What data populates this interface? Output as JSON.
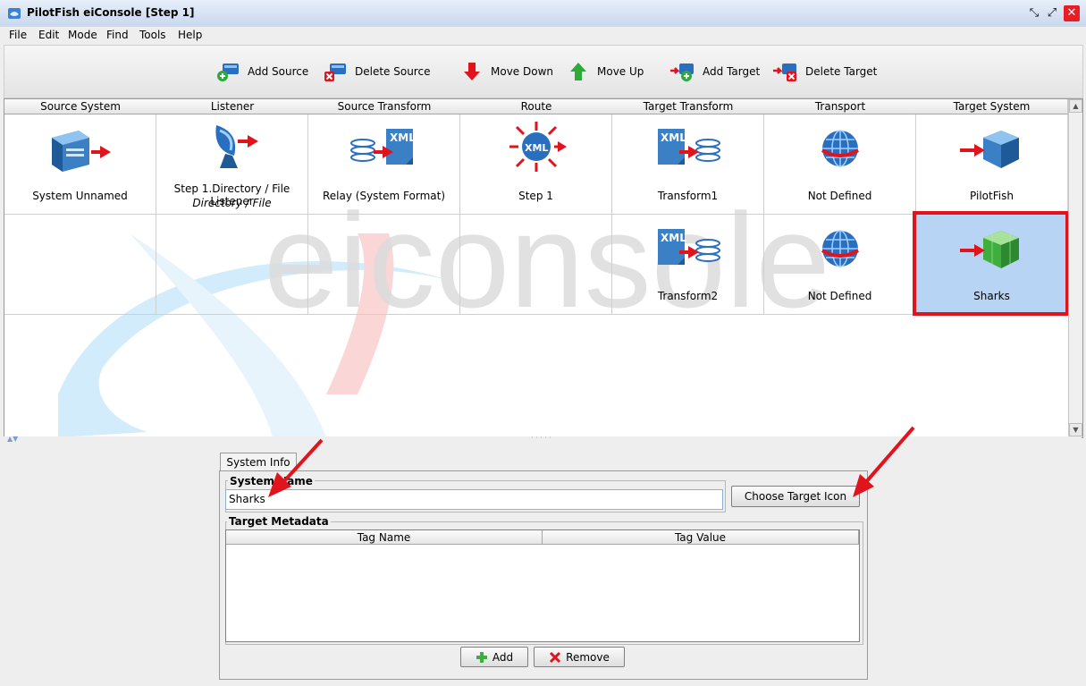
{
  "window": {
    "title": "PilotFish eiConsole [Step 1]"
  },
  "menu": [
    "File",
    "Edit",
    "Mode",
    "Find",
    "Tools",
    "Help"
  ],
  "toolbar": {
    "add_source": "Add Source",
    "delete_source": "Delete Source",
    "move_down": "Move Down",
    "move_up": "Move Up",
    "add_target": "Add Target",
    "delete_target": "Delete Target"
  },
  "grid": {
    "columns": [
      "Source System",
      "Listener",
      "Source Transform",
      "Route",
      "Target Transform",
      "Transport",
      "Target System"
    ],
    "row1": {
      "source_system": "System Unnamed",
      "listener": "Step 1.Directory / File Listener",
      "listener_sub": "Directory / File",
      "source_transform": "Relay (System Format)",
      "route": "Step 1",
      "target_transform": "Transform1",
      "transport": "Not Defined",
      "target_system": "PilotFish"
    },
    "row2": {
      "target_transform": "Transform2",
      "transport": "Not Defined",
      "target_system": "Sharks"
    },
    "watermark": "eiconsole"
  },
  "details": {
    "tab": "System Info",
    "system_name_label": "System Name",
    "system_name_value": "Sharks",
    "choose_icon_button": "Choose Target Icon",
    "metadata_label": "Target Metadata",
    "metadata_columns": [
      "Tag Name",
      "Tag Value"
    ],
    "add_button": "Add",
    "remove_button": "Remove"
  },
  "colors": {
    "selection": "#b8d4f5",
    "highlight": "#e0141c",
    "accent_blue": "#2a6fbf"
  }
}
